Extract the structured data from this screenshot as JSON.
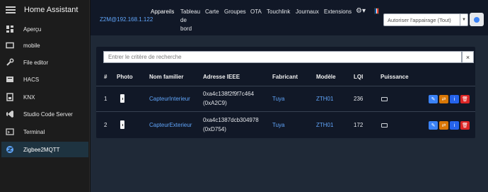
{
  "sidebar": {
    "title": "Home Assistant",
    "items": [
      {
        "label": "Aperçu",
        "icon": "dashboard-icon"
      },
      {
        "label": "mobile",
        "icon": "tablet-icon"
      },
      {
        "label": "File editor",
        "icon": "wrench-icon"
      },
      {
        "label": "HACS",
        "icon": "hacs-icon"
      },
      {
        "label": "KNX",
        "icon": "knx-icon"
      },
      {
        "label": "Studio Code Server",
        "icon": "vscode-icon"
      },
      {
        "label": "Terminal",
        "icon": "terminal-icon"
      },
      {
        "label": "Zigbee2MQTT",
        "icon": "zigbee-icon"
      }
    ]
  },
  "topbar": {
    "brand": "Z2M@192.168.1.122",
    "nav": {
      "devices": "Appareils",
      "dashboard_1": "Tableau",
      "dashboard_2": "de",
      "dashboard_3": "bord",
      "map": "Carte",
      "groups": "Groupes",
      "ota": "OTA",
      "touchlink": "Touchlink",
      "logs": "Journaux",
      "extensions": "Extensions"
    },
    "settings_icon": "gear-icon",
    "language_flag": "fr-flag-icon",
    "flag_colors": [
      "#0055a4",
      "#ffffff",
      "#ef4135"
    ],
    "permit_join_select": "Autoriser l'appairage (Tout)",
    "permit_join_button_icon": "circle-icon"
  },
  "search": {
    "placeholder": "Entrer le critère de recherche",
    "clear_label": "×"
  },
  "table": {
    "headers": {
      "num": "#",
      "photo": "Photo",
      "name": "Nom familier",
      "ieee": "Adresse IEEE",
      "manufacturer": "Fabricant",
      "model": "Modèle",
      "lqi": "LQI",
      "power": "Puissance"
    },
    "rows": [
      {
        "num": "1",
        "name": "CapteurInterieur",
        "ieee": "0xa4c138f2f9f7c464",
        "nwk": "(0xA2C9)",
        "manufacturer": "Tuya",
        "model": "ZTH01",
        "lqi": "236",
        "power_icon": "battery-icon"
      },
      {
        "num": "2",
        "name": "CapteurExterieur",
        "ieee": "0xa4c1387dcb304978",
        "nwk": "(0xD754)",
        "manufacturer": "Tuya",
        "model": "ZTH01",
        "lqi": "172",
        "power_icon": "battery-icon"
      }
    ],
    "actions": {
      "rename": "✎",
      "reconfigure": "⇄",
      "info": "i",
      "remove": "🗑"
    }
  }
}
